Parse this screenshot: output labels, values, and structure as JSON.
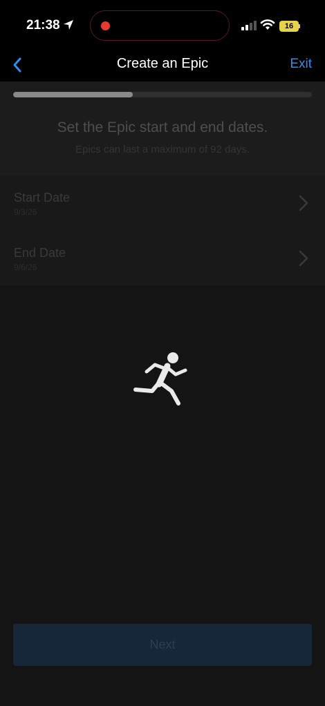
{
  "status_bar": {
    "time": "21:38",
    "battery": "16",
    "icons": [
      "location-arrow-icon",
      "record-dot-icon",
      "signal-icon",
      "wifi-icon",
      "battery-icon"
    ]
  },
  "nav": {
    "back_icon": "chevron-left-icon",
    "title": "Create an Epic",
    "exit_label": "Exit"
  },
  "progress": {
    "value": 0.4
  },
  "header": {
    "title": "Set the Epic start and end dates.",
    "subtitle": "Epics can last a maximum of 92 days."
  },
  "dates": [
    {
      "label": "Start Date",
      "value": "9/3/26"
    },
    {
      "label": "End Date",
      "value": "9/6/26"
    }
  ],
  "loading_icon": "running-person-icon",
  "footer": {
    "next_label": "Next"
  },
  "colors": {
    "accent": "#2f8ff0",
    "background": "#141414",
    "next_button": "#17273a",
    "recording": "#e8392f",
    "battery": "#e6d24b"
  }
}
